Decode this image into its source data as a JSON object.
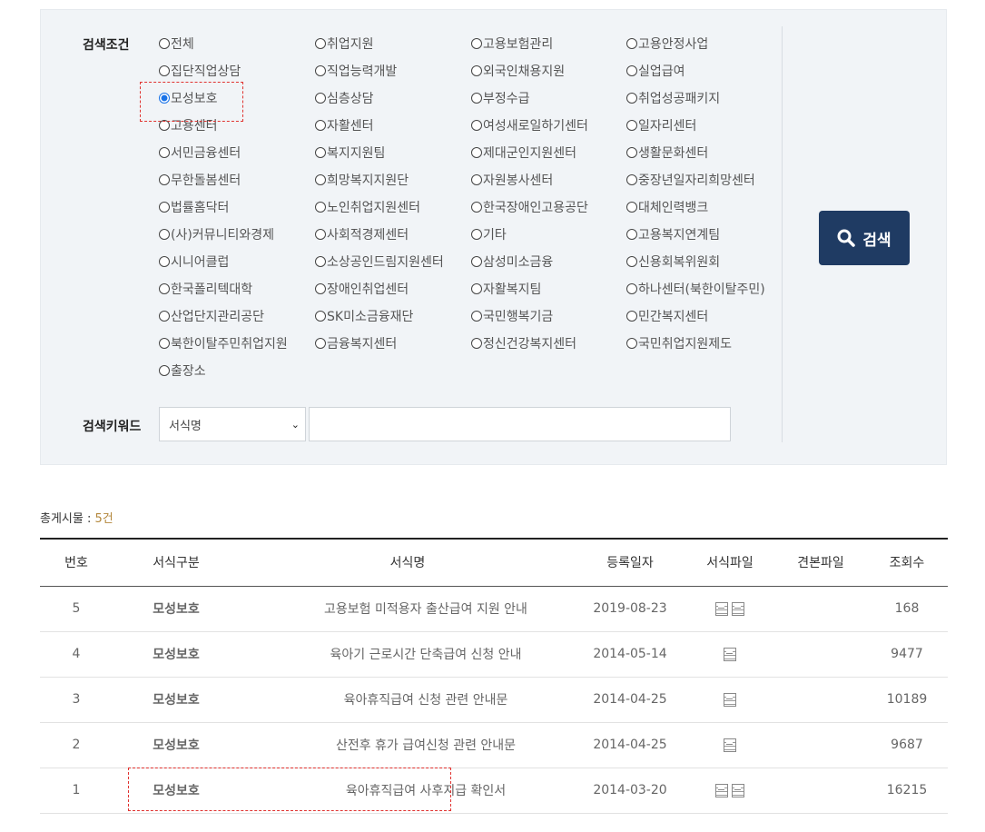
{
  "search": {
    "condition_label": "검색조건",
    "keyword_label": "검색키워드",
    "keyword_select_value": "서식명",
    "keyword_input_value": "",
    "search_button_label": "검색",
    "selected_option": "모성보호",
    "options": [
      "전체",
      "취업지원",
      "고용보험관리",
      "고용안정사업",
      "집단직업상담",
      "직업능력개발",
      "외국인채용지원",
      "실업급여",
      "모성보호",
      "심층상담",
      "부정수급",
      "취업성공패키지",
      "고용센터",
      "자활센터",
      "여성새로일하기센터",
      "일자리센터",
      "서민금융센터",
      "복지지원팀",
      "제대군인지원센터",
      "생활문화센터",
      "무한돌봄센터",
      "희망복지지원단",
      "자원봉사센터",
      "중장년일자리희망센터",
      "법률홈닥터",
      "노인취업지원센터",
      "한국장애인고용공단",
      "대체인력뱅크",
      "(사)커뮤니티와경제",
      "사회적경제센터",
      "기타",
      "고용복지연계팀",
      "시니어클럽",
      "소상공인드림지원센터",
      "삼성미소금융",
      "신용회복위원회",
      "한국폴리텍대학",
      "장애인취업센터",
      "자활복지팀",
      "하나센터(북한이탈주민)",
      "산업단지관리공단",
      "SK미소금융재단",
      "국민행복기금",
      "민간복지센터",
      "북한이탈주민취업지원",
      "금융복지센터",
      "정신건강복지센터",
      "국민취업지원제도",
      "출장소"
    ]
  },
  "list": {
    "total_prefix": "총게시물 : ",
    "total_count": "5건",
    "headers": [
      "번호",
      "서식구분",
      "서식명",
      "등록일자",
      "서식파일",
      "견본파일",
      "조회수"
    ],
    "rows": [
      {
        "no": "5",
        "category": "모성보호",
        "title": "고용보험 미적용자 출산급여 지원 안내",
        "date": "2019-08-23",
        "files": 2,
        "samples": 0,
        "views": "168"
      },
      {
        "no": "4",
        "category": "모성보호",
        "title": "육아기 근로시간 단축급여 신청 안내",
        "date": "2014-05-14",
        "files": 1,
        "samples": 0,
        "views": "9477"
      },
      {
        "no": "3",
        "category": "모성보호",
        "title": "육아휴직급여 신청 관련 안내문",
        "date": "2014-04-25",
        "files": 1,
        "samples": 0,
        "views": "10189"
      },
      {
        "no": "2",
        "category": "모성보호",
        "title": "산전후 휴가 급여신청 관련 안내문",
        "date": "2014-04-25",
        "files": 1,
        "samples": 0,
        "views": "9687"
      },
      {
        "no": "1",
        "category": "모성보호",
        "title": "육아휴직급여 사후지급 확인서",
        "date": "2014-03-20",
        "files": 2,
        "samples": 0,
        "views": "16215"
      }
    ]
  }
}
